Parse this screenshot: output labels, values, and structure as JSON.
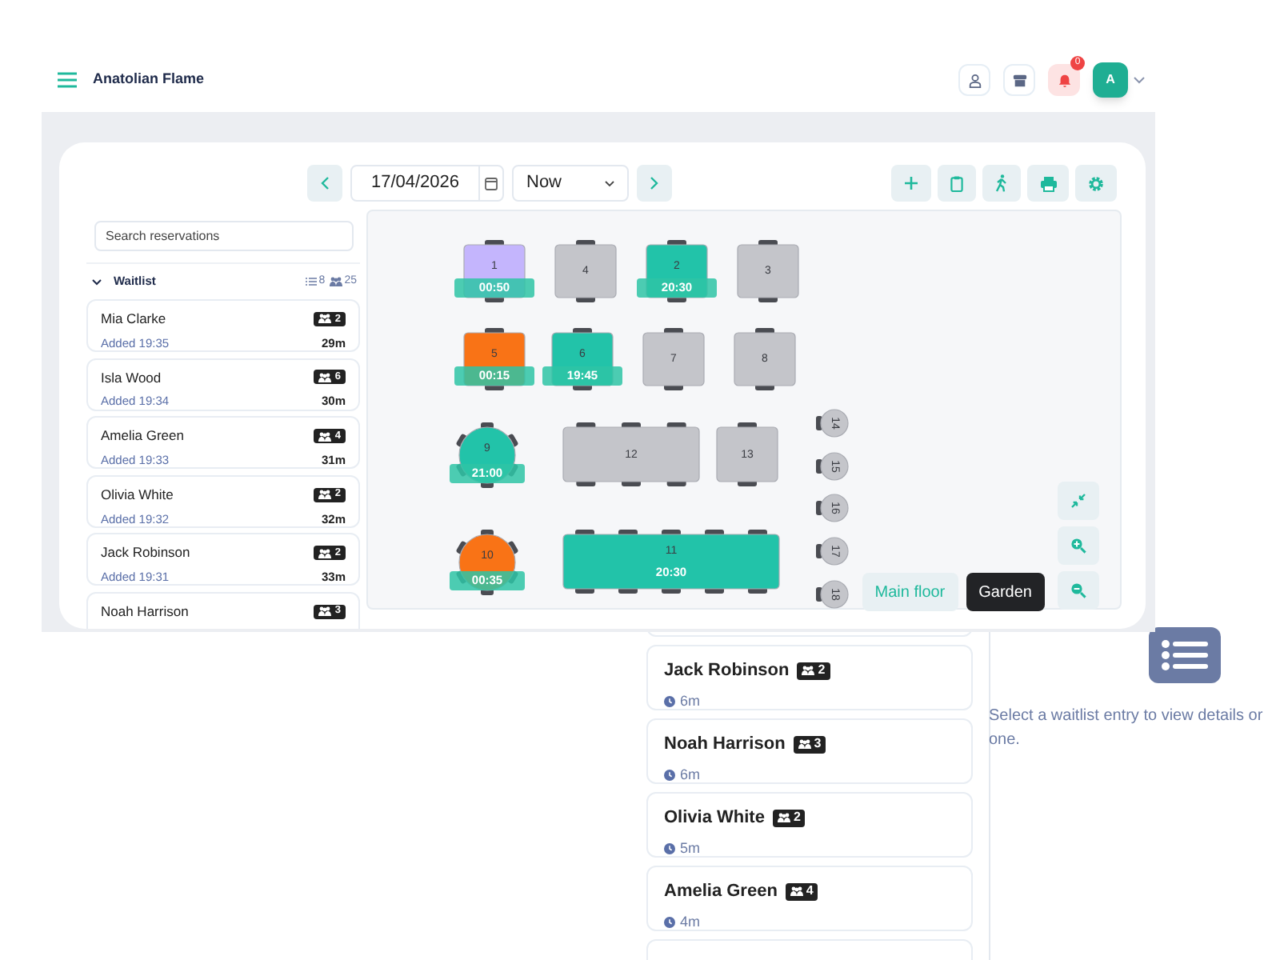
{
  "header": {
    "title": "Anatolian Flame",
    "notification_count": "0",
    "avatar": "A"
  },
  "toolbar": {
    "date": "17/04/2026",
    "time": "Now"
  },
  "waitlist": {
    "search_placeholder": "Search reservations",
    "title": "Waitlist",
    "expanded": true,
    "entry_count": "8",
    "guest_count": "25",
    "entries": [
      {
        "name": "Mia Clarke",
        "added": "Added 19:35",
        "party": "2",
        "wait": "29m"
      },
      {
        "name": "Isla Wood",
        "added": "Added 19:34",
        "party": "6",
        "wait": "30m"
      },
      {
        "name": "Amelia Green",
        "added": "Added 19:33",
        "party": "4",
        "wait": "31m"
      },
      {
        "name": "Olivia White",
        "added": "Added 19:32",
        "party": "2",
        "wait": "32m"
      },
      {
        "name": "Jack Robinson",
        "added": "Added 19:31",
        "party": "2",
        "wait": "33m"
      },
      {
        "name": "Noah Harrison",
        "party": "3"
      }
    ]
  },
  "floor_plan": {
    "tables": [
      {
        "label": "1",
        "kind": "rect",
        "color": "#c4b5fd",
        "time": "00:50"
      },
      {
        "label": "4",
        "kind": "rect",
        "color": "#c4c5ca"
      },
      {
        "label": "2",
        "kind": "rect",
        "color": "#22c3a9",
        "time": "20:30"
      },
      {
        "label": "3",
        "kind": "rect",
        "color": "#c4c5ca"
      },
      {
        "label": "5",
        "kind": "rect",
        "color": "#f97316",
        "time": "00:15"
      },
      {
        "label": "6",
        "kind": "rect",
        "color": "#22c3a9",
        "time": "19:45"
      },
      {
        "label": "7",
        "kind": "rect",
        "color": "#c4c5ca"
      },
      {
        "label": "8",
        "kind": "rect",
        "color": "#c4c5ca"
      },
      {
        "label": "9",
        "kind": "round",
        "color": "#22c3a9",
        "time": "21:00"
      },
      {
        "label": "12",
        "kind": "rect",
        "color": "#c4c5ca"
      },
      {
        "label": "13",
        "kind": "rect",
        "color": "#c4c5ca"
      },
      {
        "label": "10",
        "kind": "round",
        "color": "#f97316",
        "time": "00:35"
      },
      {
        "label": "11",
        "kind": "rect",
        "color": "#22c3a9",
        "time": "20:30"
      },
      {
        "label": "14",
        "kind": "stool",
        "color": "#c4c5ca"
      },
      {
        "label": "15",
        "kind": "stool",
        "color": "#c4c5ca"
      },
      {
        "label": "16",
        "kind": "stool",
        "color": "#c4c5ca"
      },
      {
        "label": "17",
        "kind": "stool",
        "color": "#c4c5ca"
      },
      {
        "label": "18",
        "kind": "stool",
        "color": "#c4c5ca"
      }
    ],
    "areas": [
      {
        "label": "Main floor",
        "selected": false
      },
      {
        "label": "Garden",
        "selected": true
      }
    ]
  },
  "background_list": {
    "entries": [
      {
        "name": "Jack Robinson",
        "party": "2",
        "wait": "6m"
      },
      {
        "name": "Noah Harrison",
        "party": "3",
        "wait": "6m"
      },
      {
        "name": "Olivia White",
        "party": "2",
        "wait": "5m"
      },
      {
        "name": "Amelia Green",
        "party": "4",
        "wait": "4m"
      }
    ],
    "message_lines": [
      "Select a waitlist entry to view details or",
      "one."
    ]
  }
}
